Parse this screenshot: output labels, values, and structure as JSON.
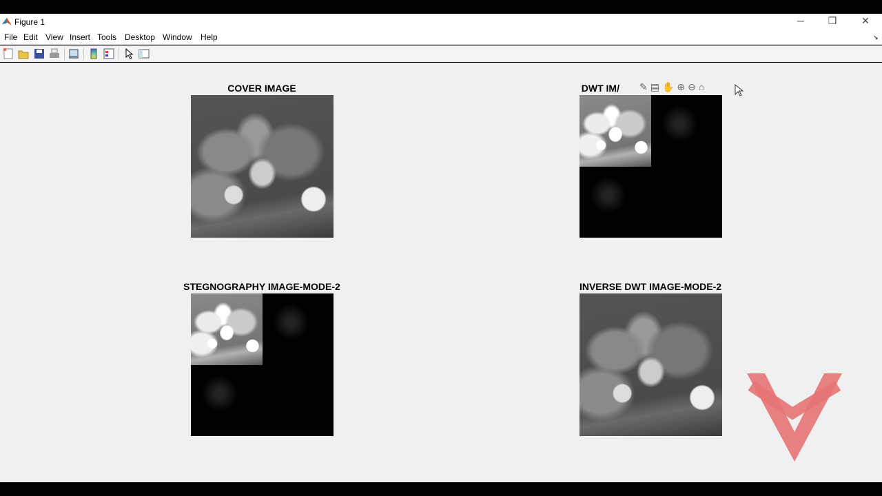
{
  "window": {
    "title": "Figure 1",
    "minimize": "─",
    "restore": "❐",
    "close": "✕"
  },
  "menu": [
    "File",
    "Edit",
    "View",
    "Insert",
    "Tools",
    "Desktop",
    "Window",
    "Help"
  ],
  "axes_toolbar": {
    "icons": [
      "brush-icon",
      "data-tip-icon",
      "pan-icon",
      "zoom-in-icon",
      "zoom-out-icon",
      "home-icon"
    ],
    "glyphs": "✎▤✋⊕⊖⌂"
  },
  "plots": [
    {
      "title": "COVER IMAGE"
    },
    {
      "title": "DWT IM/"
    },
    {
      "title": "STEGNOGRAPHY IMAGE-MODE-2"
    },
    {
      "title": "INVERSE DWT IMAGE-MODE-2"
    }
  ],
  "colors": {
    "watermark": "#e57373"
  }
}
